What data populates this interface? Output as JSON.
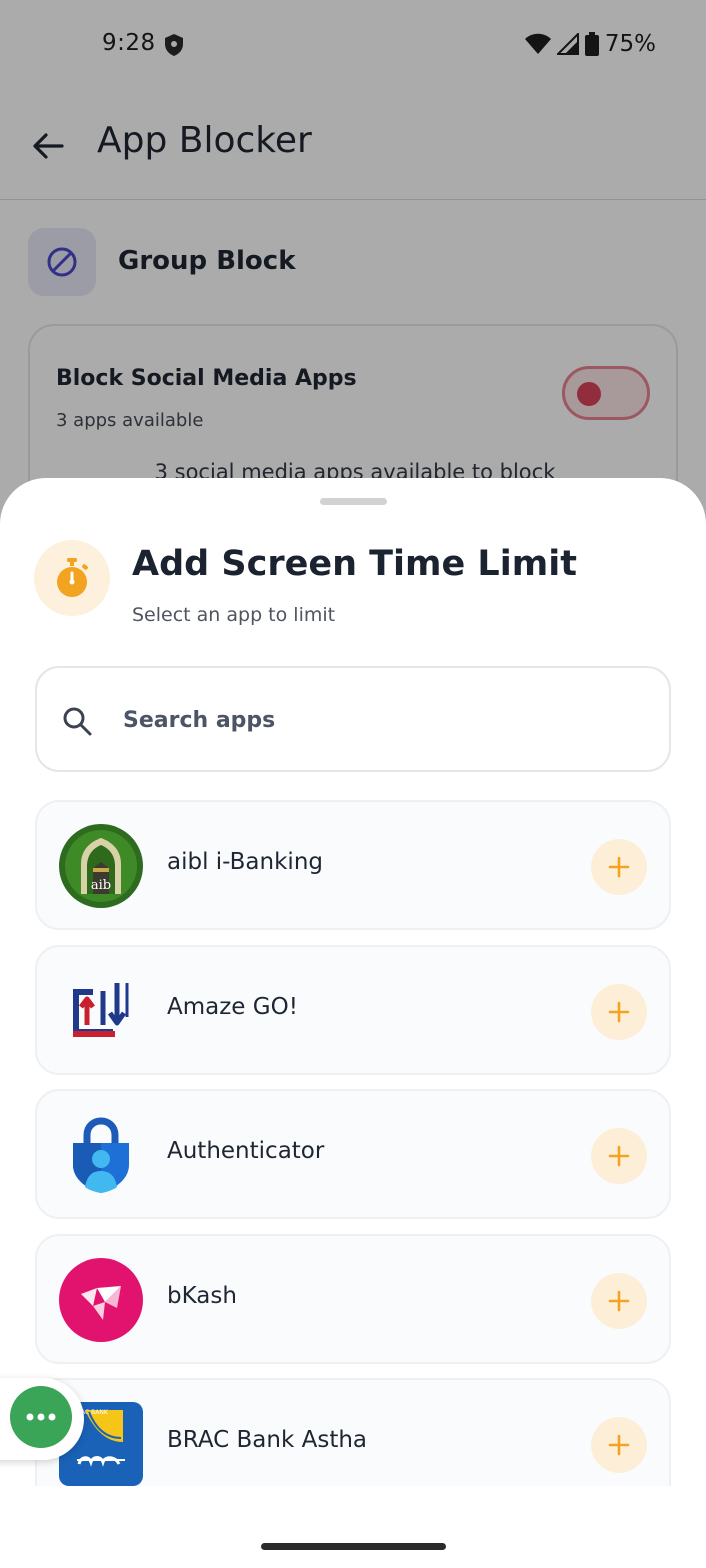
{
  "status_bar": {
    "time": "9:28",
    "battery": "75%"
  },
  "app_bar": {
    "title": "App Blocker",
    "back_icon": "arrow-left-icon"
  },
  "group_block": {
    "icon": "block-icon",
    "title": "Group Block"
  },
  "social_card": {
    "title": "Block Social Media Apps",
    "subtitle": "3 apps available",
    "note": "3 social media apps available to block",
    "toggle_on": false
  },
  "sheet": {
    "icon": "stopwatch-icon",
    "title": "Add Screen Time Limit",
    "subtitle": "Select an app to limit",
    "search": {
      "placeholder": "Search apps",
      "value": ""
    },
    "apps": [
      {
        "name": "aibl i-Banking",
        "logo_text": "aib"
      },
      {
        "name": "Amaze GO!"
      },
      {
        "name": "Authenticator"
      },
      {
        "name": "bKash"
      },
      {
        "name": "BRAC Bank Astha",
        "logo_text": "BRAC BANK"
      }
    ]
  },
  "colors": {
    "accent_orange": "#f2a320",
    "accent_orange_bg": "#fdeed8",
    "toggle_red": "#d9435a",
    "fab_green": "#3aa457"
  }
}
